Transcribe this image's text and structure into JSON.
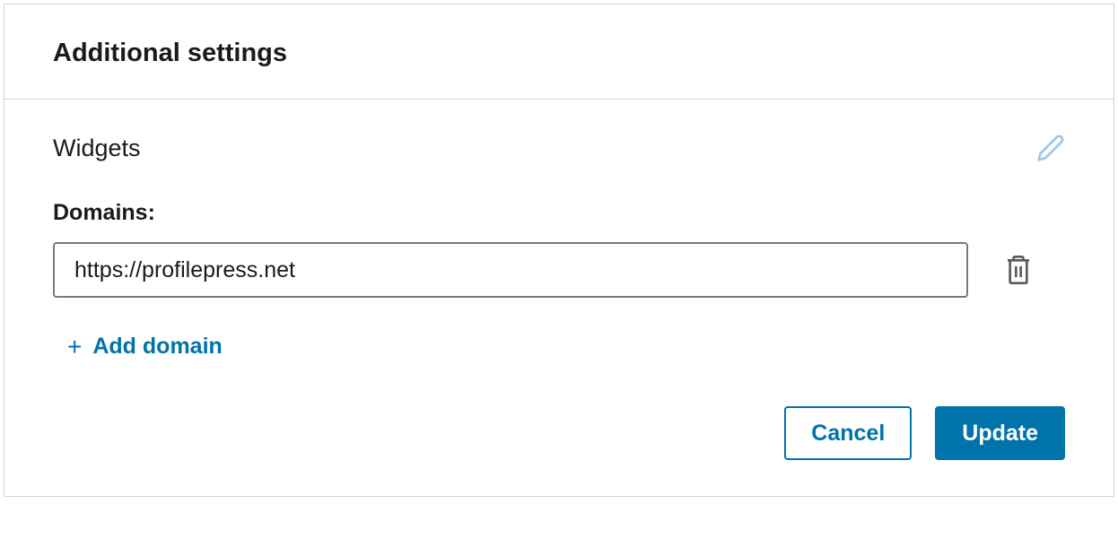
{
  "header": {
    "title": "Additional settings"
  },
  "widgets": {
    "section_label": "Widgets",
    "domains_label": "Domains:",
    "domain_value": "https://profilepress.net",
    "add_domain_label": "Add domain"
  },
  "buttons": {
    "cancel": "Cancel",
    "update": "Update"
  }
}
